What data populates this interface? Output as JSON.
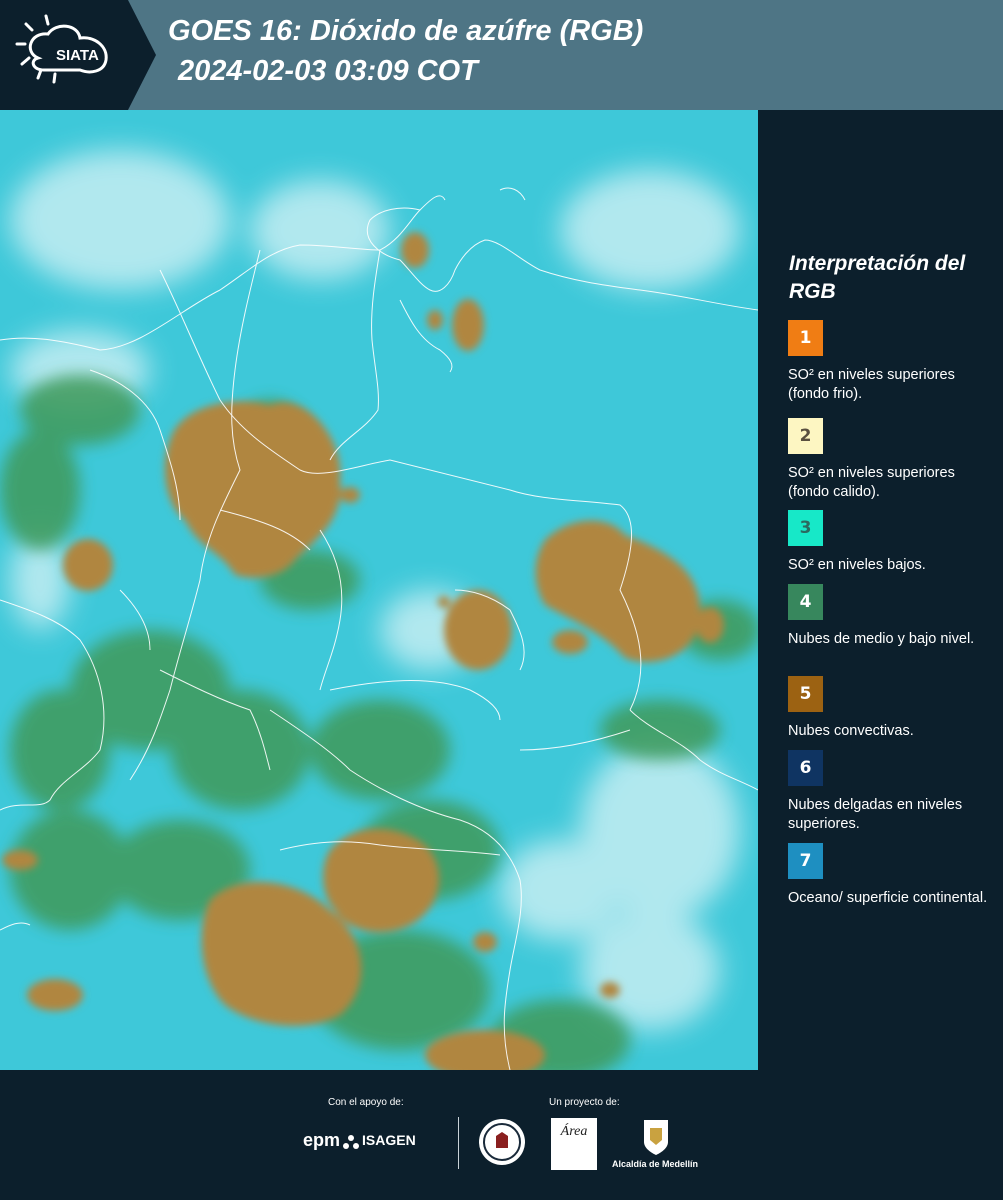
{
  "header": {
    "brand": "SIATA",
    "title_line1": "GOES 16: Dióxido de azúfre (RGB)",
    "title_line2": "2024-02-03 03:09 COT",
    "background": "#4e7585"
  },
  "map": {
    "content": "satellite-rgb-image",
    "colors": {
      "background": "#3ec8d9",
      "convective": "#b0863f",
      "mid_low_cloud": "#3f9a5a",
      "thin_high_cloud": "#d8f3f6",
      "borders": "#ffffff"
    }
  },
  "legend": {
    "title": "Interpretación del RGB",
    "items": [
      {
        "num": "1",
        "color": "#f07d14",
        "text": "SO² en niveles superiores (fondo frio)."
      },
      {
        "num": "2",
        "color": "#fdf6c2",
        "text": "SO² en niveles superiores (fondo calido)."
      },
      {
        "num": "3",
        "color": "#17e8c8",
        "text": "SO² en niveles bajos."
      },
      {
        "num": "4",
        "color": "#37875d",
        "text": "Nubes de medio y bajo nivel."
      },
      {
        "num": "5",
        "color": "#9c6212",
        "text": "Nubes convectivas."
      },
      {
        "num": "6",
        "color": "#0f3462",
        "text": "Nubes delgadas en niveles superiores."
      },
      {
        "num": "7",
        "color": "#1e8fc1",
        "text": "Oceano/ superficie continental."
      }
    ]
  },
  "footer": {
    "support_label": "Con el apoyo de:",
    "project_label": "Un proyecto de:",
    "epm": "epm",
    "isagen": "ISAGEN",
    "area_logo": "Área",
    "alcaldia": "Alcaldía de Medellín"
  }
}
